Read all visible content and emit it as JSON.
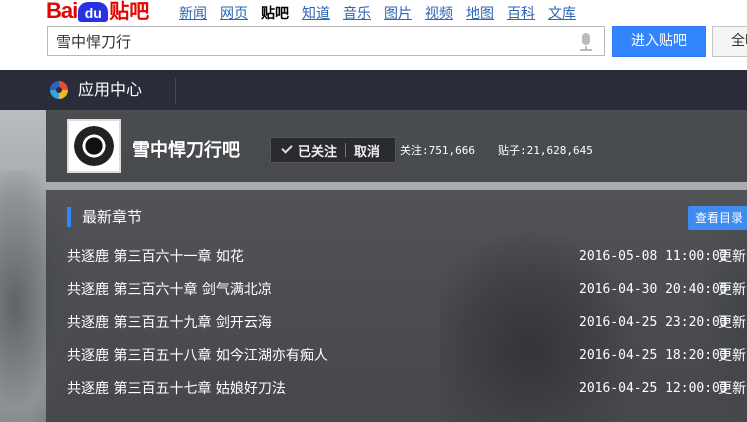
{
  "logo": {
    "bai": "Bai",
    "du": "du",
    "tieba": "贴吧"
  },
  "nav": [
    "新闻",
    "网页",
    "贴吧",
    "知道",
    "音乐",
    "图片",
    "视频",
    "地图",
    "百科",
    "文库"
  ],
  "search": {
    "value": "雪中悍刀行",
    "enter_label": "进入贴吧",
    "all_label": "全吧"
  },
  "appbar": {
    "label": "应用中心"
  },
  "forum": {
    "name": "雪中悍刀行吧",
    "followed_label": "已关注",
    "cancel_label": "取消",
    "followers": "关注:751,666",
    "posts": "贴子:21,628,645"
  },
  "panel": {
    "heading": "最新章节",
    "catalog_label": "查看目录",
    "chapters": [
      {
        "title": "共逐鹿 第三百六十一章 如花",
        "time": "2016-05-08 11:00:02",
        "status": "更新"
      },
      {
        "title": "共逐鹿 第三百六十章 剑气满北凉",
        "time": "2016-04-30 20:40:05",
        "status": "更新"
      },
      {
        "title": "共逐鹿 第三百五十九章 剑开云海",
        "time": "2016-04-25 23:20:03",
        "status": "更新"
      },
      {
        "title": "共逐鹿 第三百五十八章 如今江湖亦有痴人",
        "time": "2016-04-25 18:20:03",
        "status": "更新"
      },
      {
        "title": "共逐鹿 第三百五十七章 姑娘好刀法",
        "time": "2016-04-25 12:00:03",
        "status": "更新"
      }
    ]
  },
  "colors": {
    "accent": "#3385ff",
    "brand_red": "#e10601",
    "header_dark": "#2a2c3a"
  }
}
